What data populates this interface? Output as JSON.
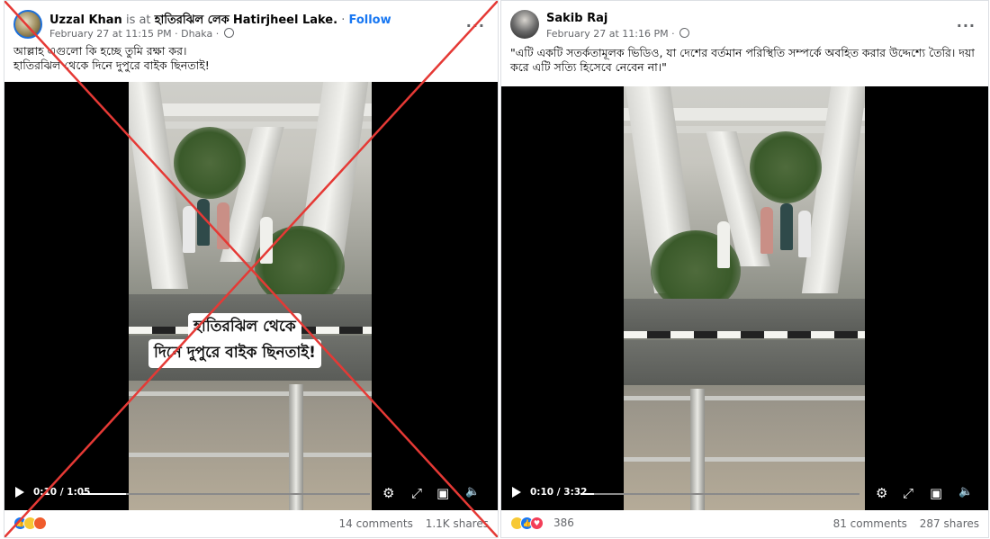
{
  "left_post": {
    "author": "Uzzal Khan",
    "is_at": "is at",
    "location_bn": "হাতিরঝিল লেক",
    "location_en": "Hatirjheel Lake.",
    "separator": "·",
    "follow_label": "Follow",
    "date": "February 27 at 11:15 PM",
    "place": "Dhaka",
    "more_label": "···",
    "caption_line1": "আল্লাহ এগুলো কি হচ্ছে তুমি রক্ষা কর।",
    "caption_line2": "হাতিরঝিল থেকে দিনে দুপুরে বাইক ছিনতাই!",
    "video_overlay_line1": "হাতিরঝিল থেকে",
    "video_overlay_line2": "দিনে দুপুরে বাইক ছিনতাই!",
    "video_time": "0:10 / 1:05",
    "video_progress": 0.154,
    "comments": "14 comments",
    "shares": "1.1K shares",
    "reactions": [
      "like",
      "sad",
      "angry"
    ],
    "crossed_out": true,
    "cross_color": "#e53935"
  },
  "right_post": {
    "author": "Sakib Raj",
    "date": "February 27 at 11:16 PM",
    "more_label": "···",
    "caption_line1": "\"এটি একটি সতর্কতামূলক ভিডিও, যা দেশের বর্তমান পরিস্থিতি সম্পর্কে অবহিত করার উদ্দেশ্যে তৈরি। দয়া",
    "caption_line2": "করে এটি সত্যি হিসেবে নেবেন না।\"",
    "video_time": "0:10 / 3:32",
    "video_progress": 0.047,
    "reaction_count": "386",
    "comments": "81 comments",
    "shares": "287 shares",
    "reactions": [
      "haha",
      "like",
      "love"
    ]
  },
  "icons": {
    "globe": "globe-icon",
    "settings": "⚙",
    "fullscreen": "⤢",
    "pip": "▣",
    "mute": "🔈",
    "play": "play-icon"
  },
  "colors": {
    "link": "#1877f2",
    "muted": "#65676b",
    "like": "#1877f2",
    "love": "#f33e58",
    "haha": "#f7c935"
  }
}
